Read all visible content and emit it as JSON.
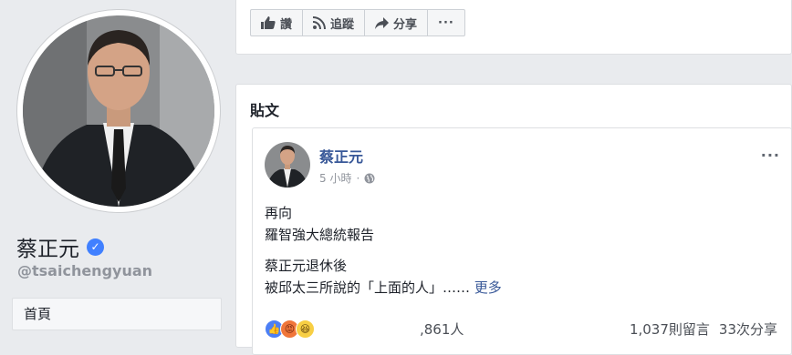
{
  "profile": {
    "name": "蔡正元",
    "handle": "@tsaichengyuan",
    "home_tab": "首頁"
  },
  "actions": [
    {
      "label": "讚",
      "icon": "thumbs-up-icon"
    },
    {
      "label": "追蹤",
      "icon": "rss-icon"
    },
    {
      "label": "分享",
      "icon": "share-arrow-icon"
    },
    {
      "label": "",
      "icon": "more-icon"
    }
  ],
  "posts_section": {
    "title": "貼文"
  },
  "post": {
    "author": "蔡正元",
    "time": "5 小時",
    "privacy_icon": "globe-icon",
    "more_icon": "···",
    "lines_a": [
      "再向",
      "羅智強大總統報告"
    ],
    "lines_b": [
      "蔡正元退休後",
      "被邱太三所說的「上面的人」……"
    ],
    "see_more": "更多",
    "reaction_icons": [
      "like",
      "angry",
      "haha"
    ],
    "reaction_count": ",861人",
    "comments": "1,037則留言",
    "shares": "33次分享"
  },
  "colors": {
    "link": "#385898",
    "verified": "#4080ff",
    "background": "#e9ebee"
  }
}
